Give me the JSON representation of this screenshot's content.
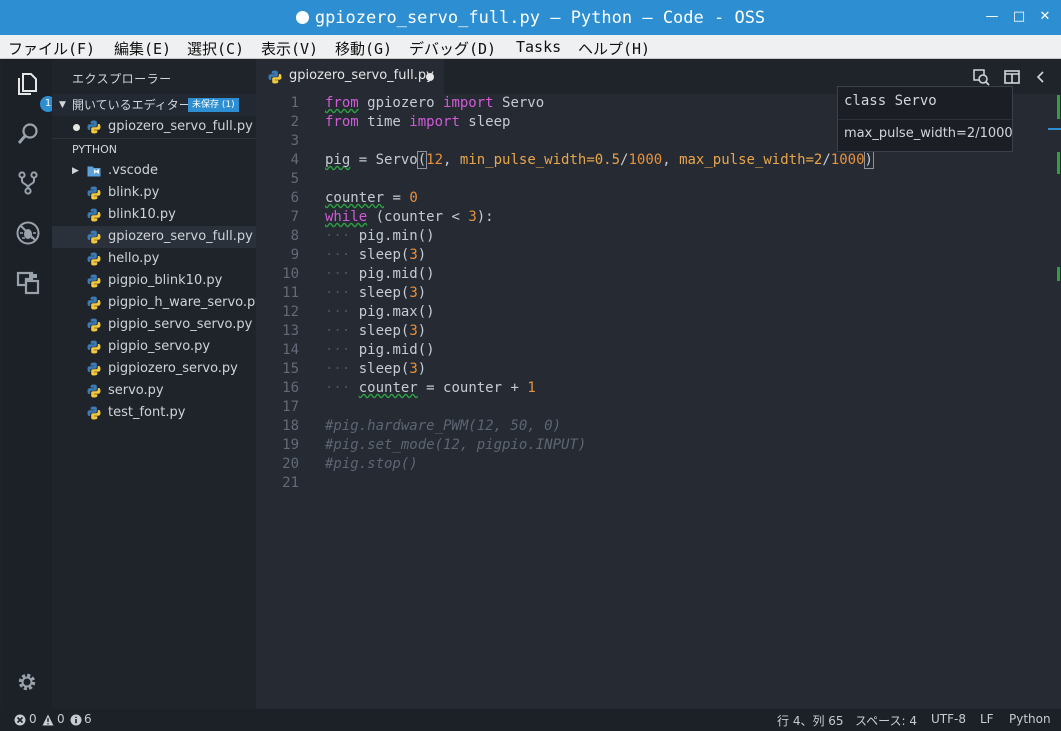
{
  "window": {
    "title": "gpiozero_servo_full.py — Python — Code - OSS"
  },
  "menu": [
    "ファイル(F)",
    "編集(E)",
    "選択(C)",
    "表示(V)",
    "移動(G)",
    "デバッグ(D)",
    "Tasks",
    "ヘルプ(H)"
  ],
  "activity": {
    "explorer_badge": "1"
  },
  "sidebar": {
    "title": "エクスプローラー",
    "open_editors_label": "開いているエディター",
    "unsaved_badge": "未保存 (1)",
    "open_file": "gpiozero_servo_full.py",
    "folder_label": "PYTHON",
    "files": [
      ".vscode",
      "blink.py",
      "blink10.py",
      "gpiozero_servo_full.py",
      "hello.py",
      "pigpio_blink10.py",
      "pigpio_h_ware_servo.py",
      "pigpio_servo_servo.py",
      "pigpio_servo.py",
      "pigpiozero_servo.py",
      "servo.py",
      "test_font.py"
    ]
  },
  "editor": {
    "tab_label": "gpiozero_servo_full.py",
    "line_numbers": [
      "1",
      "2",
      "3",
      "4",
      "5",
      "6",
      "7",
      "8",
      "9",
      "10",
      "11",
      "12",
      "13",
      "14",
      "15",
      "16",
      "17",
      "18",
      "19",
      "20",
      "21"
    ],
    "code": {
      "l1_kw1": "from",
      "l1_mod": " gpiozero ",
      "l1_kw2": "import",
      "l1_name": " Servo",
      "l2_kw1": "from",
      "l2_mod": " time ",
      "l2_kw2": "import",
      "l2_name": " sleep",
      "l4_a": "pig",
      "l4_b": " = Servo",
      "l4_p1": "(",
      "l4_n1": "12",
      "l4_c1": ", ",
      "l4_k1": "min_pulse_width=0.5",
      "l4_s1": "/",
      "l4_n2": "1000",
      "l4_c2": ", ",
      "l4_k2": "max_pulse_width=2",
      "l4_s2": "/",
      "l4_n3": "1000",
      "l4_p2": ")",
      "l6_a": "counter",
      "l6_b": " = ",
      "l6_n": "0",
      "l7_kw": "while",
      "l7_b": " (counter < ",
      "l7_n": "3",
      "l7_c": "):",
      "indent": "···",
      "l8": "pig.min()",
      "l9_a": "sleep(",
      "l9_n": "3",
      "l9_b": ")",
      "l10": "pig.mid()",
      "l11_a": "sleep(",
      "l11_n": "3",
      "l11_b": ")",
      "l12": "pig.max()",
      "l13_a": "sleep(",
      "l13_n": "3",
      "l13_b": ")",
      "l14": "pig.mid()",
      "l15_a": "sleep(",
      "l15_n": "3",
      "l15_b": ")",
      "l16_a": "counter",
      "l16_b": " = counter + ",
      "l16_n": "1",
      "l18": "#pig.hardware_PWM(12, 50, 0)",
      "l19": "#pig.set_mode(12, pigpio.INPUT)",
      "l20": "#pig.stop()"
    }
  },
  "hover": {
    "signature": "class Servo",
    "param": "max_pulse_width=2/1000"
  },
  "status": {
    "errors": "0",
    "warnings": "0",
    "infos": "6",
    "position": "行 4、列 65",
    "spaces": "スペース: 4",
    "encoding": "UTF-8",
    "eol": "LF",
    "language": "Python"
  },
  "colors": {
    "accent": "#2d8fd1",
    "keyword": "#d15bd6",
    "number": "#e8913a",
    "background": "#252a33"
  }
}
